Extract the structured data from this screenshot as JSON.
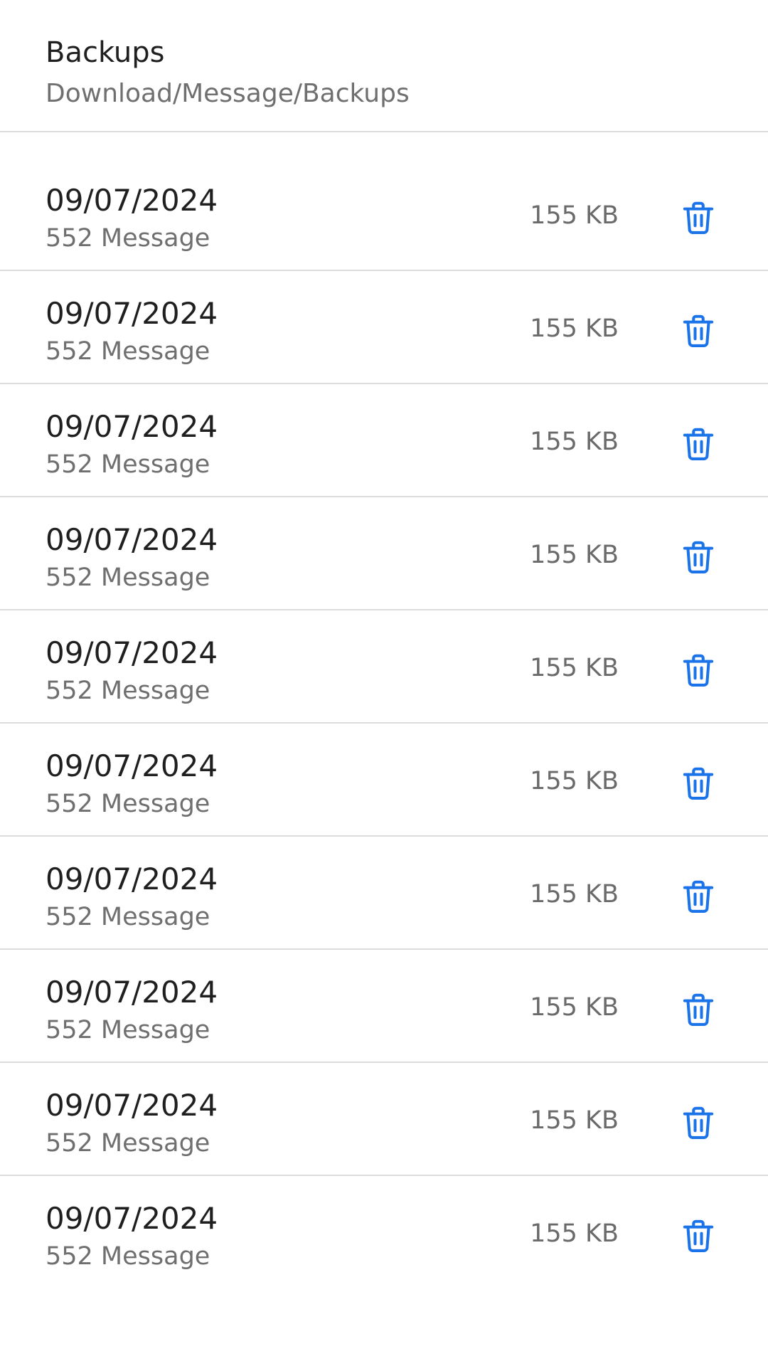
{
  "header": {
    "title": "Backups",
    "path": "Download/Message/Backups"
  },
  "backups": [
    {
      "date": "09/07/2024",
      "count": "552 Message",
      "size": "155 KB"
    },
    {
      "date": "09/07/2024",
      "count": "552 Message",
      "size": "155 KB"
    },
    {
      "date": "09/07/2024",
      "count": "552 Message",
      "size": "155 KB"
    },
    {
      "date": "09/07/2024",
      "count": "552 Message",
      "size": "155 KB"
    },
    {
      "date": "09/07/2024",
      "count": "552 Message",
      "size": "155 KB"
    },
    {
      "date": "09/07/2024",
      "count": "552 Message",
      "size": "155 KB"
    },
    {
      "date": "09/07/2024",
      "count": "552 Message",
      "size": "155 KB"
    },
    {
      "date": "09/07/2024",
      "count": "552 Message",
      "size": "155 KB"
    },
    {
      "date": "09/07/2024",
      "count": "552 Message",
      "size": "155 KB"
    },
    {
      "date": "09/07/2024",
      "count": "552 Message",
      "size": "155 KB"
    }
  ],
  "icons": {
    "delete": "trash-icon"
  },
  "colors": {
    "accent": "#1a73e8",
    "primary_text": "#1f1f1f",
    "secondary_text": "#6f6f6f",
    "divider": "#dcdcdc"
  }
}
